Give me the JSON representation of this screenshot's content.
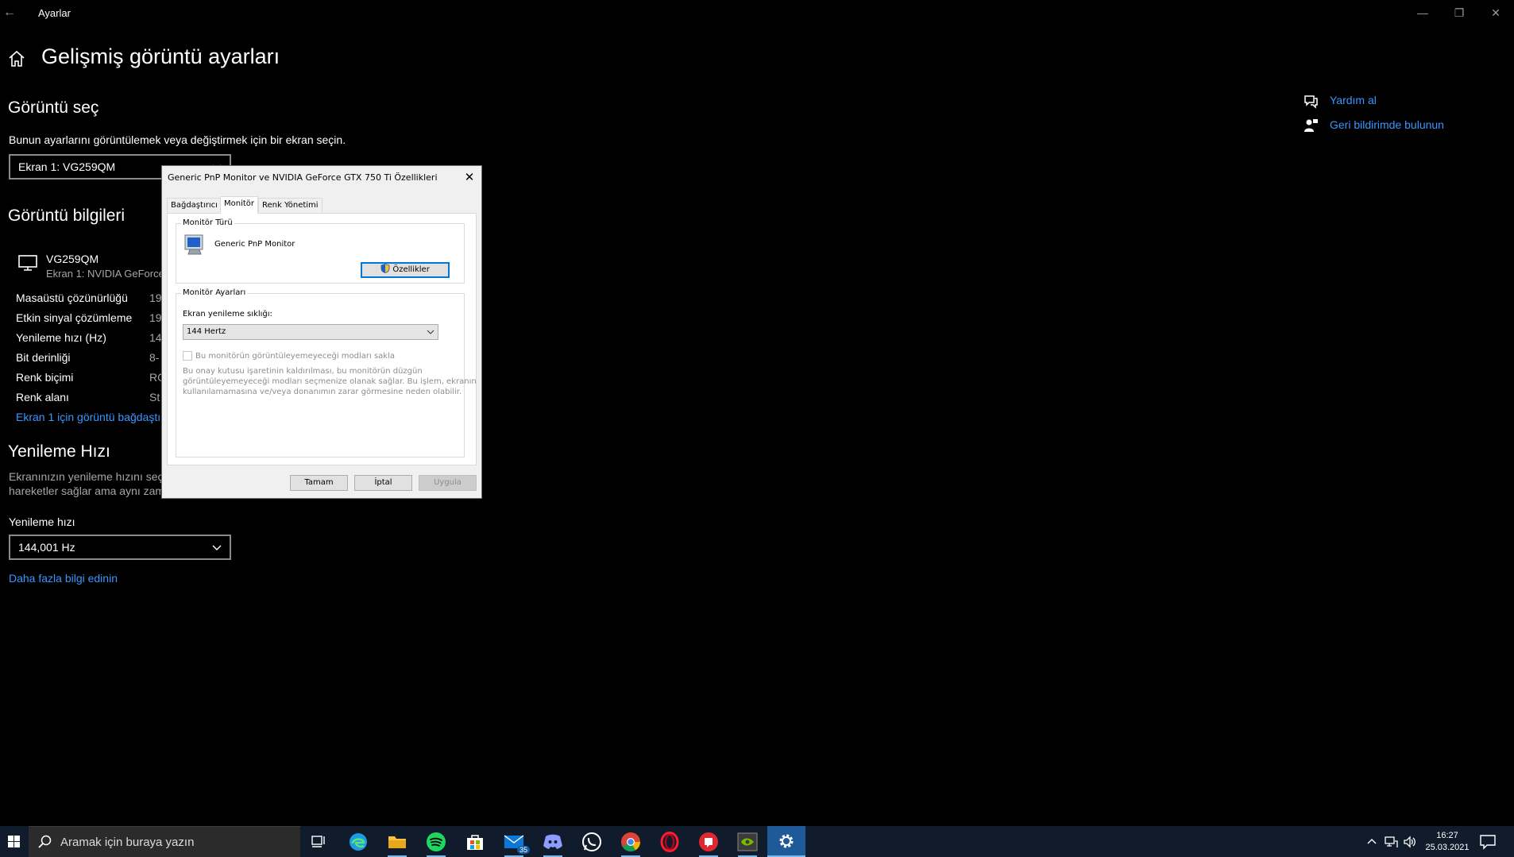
{
  "window": {
    "title": "Ayarlar"
  },
  "page": {
    "title": "Gelişmiş görüntü ayarları",
    "select_display": {
      "heading": "Görüntü seç",
      "description": "Bunun ayarlarını görüntülemek veya değiştirmek için bir ekran seçin.",
      "value": "Ekran 1: VG259QM"
    },
    "display_info": {
      "heading": "Görüntü bilgileri",
      "monitor_name": "VG259QM",
      "monitor_sub": "Ekran 1: NVIDIA GeForce",
      "rows": [
        {
          "label": "Masaüstü çözünürlüğü",
          "value": "19"
        },
        {
          "label": "Etkin sinyal çözümleme",
          "value": "19"
        },
        {
          "label": "Yenileme hızı (Hz)",
          "value": "14"
        },
        {
          "label": "Bit derinliği",
          "value": "8-"
        },
        {
          "label": "Renk biçimi",
          "value": "RG"
        },
        {
          "label": "Renk alanı",
          "value": "St"
        }
      ],
      "adapter_link": "Ekran 1 için görüntü bağdaştı"
    },
    "refresh": {
      "heading": "Yenileme Hızı",
      "desc_line1": "Ekranınızın yenileme hızını seçi",
      "desc_line2": "hareketler sağlar ama aynı zam",
      "label": "Yenileme hızı",
      "value": "144,001 Hz",
      "more_link": "Daha fazla bilgi edinin"
    }
  },
  "side_links": {
    "help": "Yardım al",
    "feedback": "Geri bildirimde bulunun"
  },
  "dialog": {
    "title": "Generic PnP Monitor ve NVIDIA GeForce GTX 750 Ti Özellikleri",
    "tabs": [
      "Bağdaştırıcı",
      "Monitör",
      "Renk Yönetimi"
    ],
    "monitor_type": {
      "legend": "Monitör Türü",
      "name": "Generic PnP Monitor",
      "properties_button": "Özellikler"
    },
    "monitor_settings": {
      "legend": "Monitör Ayarları",
      "refresh_label": "Ekran yenileme sıklığı:",
      "refresh_value": "144 Hertz",
      "checkbox_label": "Bu monitörün görüntüleyemeyeceği modları sakla",
      "note_line1": "Bu onay kutusu işaretinin kaldırılması, bu monitörün düzgün",
      "note_line2": "görüntüleyemeyeceği modları seçmenize olanak sağlar. Bu işlem, ekranın",
      "note_line3": "kullanılamamasına ve/veya donanımın zarar görmesine neden olabilir."
    },
    "buttons": {
      "ok": "Tamam",
      "cancel": "İptal",
      "apply": "Uygula"
    }
  },
  "taskbar": {
    "search_placeholder": "Aramak için buraya yazın",
    "mail_badge": "35",
    "time": "16:27",
    "date": "25.03.2021"
  }
}
